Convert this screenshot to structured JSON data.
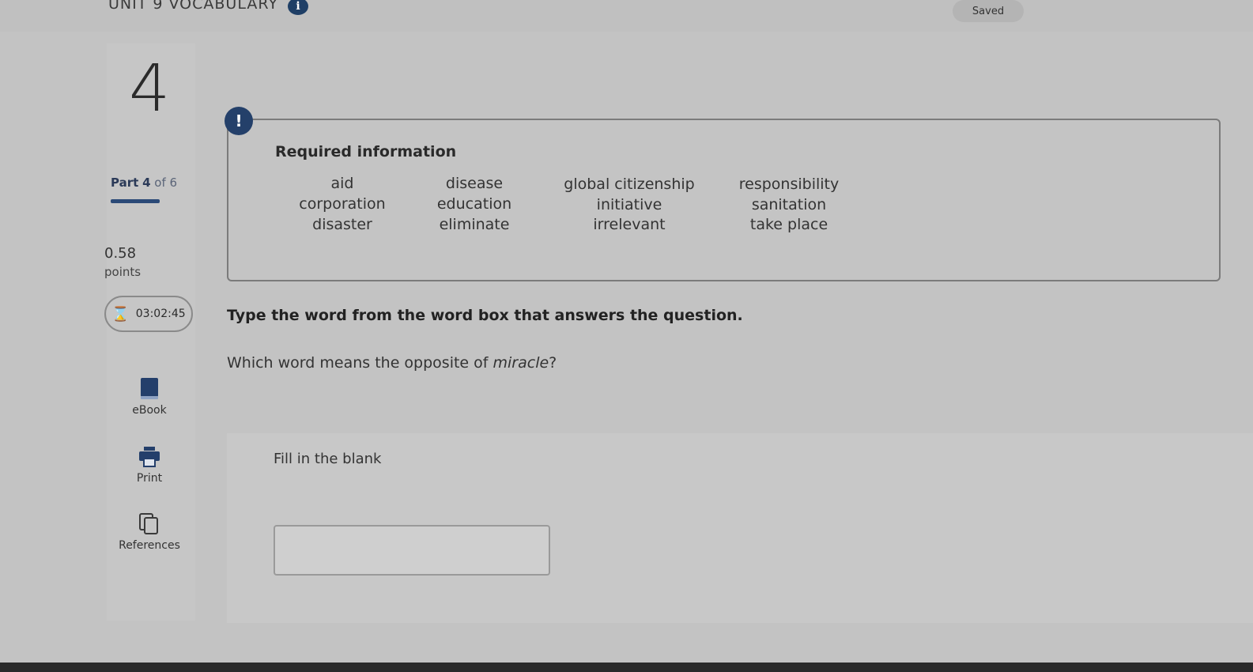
{
  "header": {
    "title": "UNIT 9 VOCABULARY",
    "info_icon": "i",
    "saved_label": "Saved"
  },
  "sidebar": {
    "question_number": "4",
    "part": {
      "label": "Part",
      "current": "4",
      "of_text": "of 6",
      "progress": 0.25
    },
    "points_value": "0.58",
    "points_label": "points",
    "timer": "03:02:45",
    "tools": [
      {
        "label": "eBook",
        "icon": "book-icon"
      },
      {
        "label": "Print",
        "icon": "printer-icon"
      },
      {
        "label": "References",
        "icon": "copy-icon"
      }
    ]
  },
  "required_info": {
    "alert_icon": "!",
    "title": "Required information",
    "words": [
      [
        "aid",
        "disease",
        "global citizenship",
        "responsibility"
      ],
      [
        "corporation",
        "education",
        "initiative",
        "sanitation"
      ],
      [
        "disaster",
        "eliminate",
        "irrelevant",
        "take place"
      ]
    ]
  },
  "question": {
    "instruction": "Type the word from the word box that answers the question.",
    "prompt_before": "Which word means the opposite of ",
    "prompt_emphasis": "miracle",
    "prompt_after": "?",
    "fill_label": "Fill in the blank",
    "answer_value": ""
  }
}
